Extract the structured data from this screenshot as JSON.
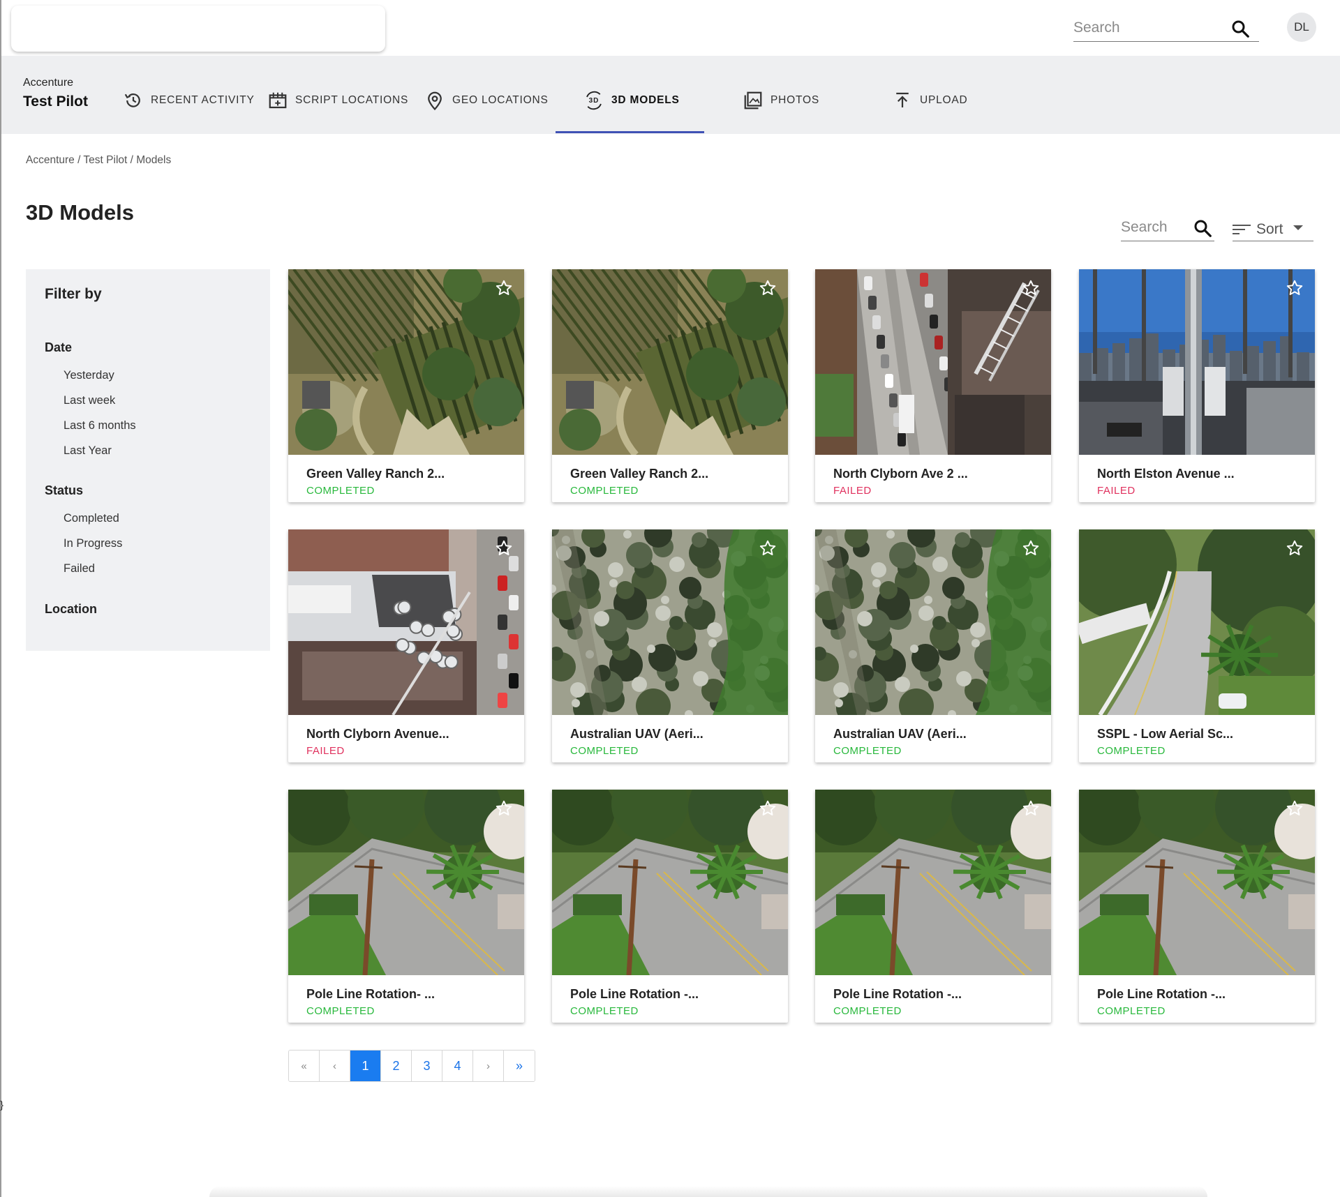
{
  "header": {
    "search_placeholder": "Search",
    "avatar_initials": "DL"
  },
  "project": {
    "org": "Accenture",
    "name": "Test Pilot"
  },
  "nav": {
    "items": [
      {
        "label": "RECENT ACTIVITY",
        "icon": "history-icon"
      },
      {
        "label": "SCRIPT LOCATIONS",
        "icon": "script-locations-icon"
      },
      {
        "label": "GEO LOCATIONS",
        "icon": "map-pin-icon"
      },
      {
        "label": "3D MODELS",
        "icon": "3d-rotation-icon"
      },
      {
        "label": "PHOTOS",
        "icon": "photo-library-icon"
      },
      {
        "label": "UPLOAD",
        "icon": "upload-icon"
      }
    ],
    "active": "3D MODELS"
  },
  "breadcrumb": "Accenture / Test Pilot / Models",
  "page_title": "3D Models",
  "toolbar": {
    "search_placeholder": "Search",
    "sort_label": "Sort"
  },
  "filter": {
    "title": "Filter by",
    "date_title": "Date",
    "date_options": [
      "Yesterday",
      "Last week",
      "Last 6 months",
      "Last Year"
    ],
    "status_title": "Status",
    "status_options": [
      "Completed",
      "In Progress",
      "Failed"
    ],
    "location_title": "Location"
  },
  "models": [
    {
      "name": "Green Valley Ranch 2...",
      "status": "COMPLETED",
      "thumb": "vineyard"
    },
    {
      "name": "Green Valley Ranch 2...",
      "status": "COMPLETED",
      "thumb": "vineyard"
    },
    {
      "name": "North Clyborn Ave 2 ...",
      "status": "FAILED",
      "thumb": "street-tower"
    },
    {
      "name": "North Elston Avenue ...",
      "status": "FAILED",
      "thumb": "tower-sky"
    },
    {
      "name": "North Clyborn Avenue...",
      "status": "FAILED",
      "thumb": "rooftop"
    },
    {
      "name": "Australian UAV (Aeri...",
      "status": "COMPLETED",
      "thumb": "scrubland"
    },
    {
      "name": "Australian UAV (Aeri...",
      "status": "COMPLETED",
      "thumb": "scrubland"
    },
    {
      "name": "SSPL - Low Aerial Sc...",
      "status": "COMPLETED",
      "thumb": "curved-road"
    },
    {
      "name": "Pole Line Rotation- ...",
      "status": "COMPLETED",
      "thumb": "pole-road"
    },
    {
      "name": "Pole Line Rotation -...",
      "status": "COMPLETED",
      "thumb": "pole-road"
    },
    {
      "name": "Pole Line Rotation -...",
      "status": "COMPLETED",
      "thumb": "pole-road"
    },
    {
      "name": "Pole Line Rotation -...",
      "status": "COMPLETED",
      "thumb": "pole-road"
    }
  ],
  "pagination": {
    "first": "«",
    "prev": "‹",
    "pages": [
      "1",
      "2",
      "3",
      "4"
    ],
    "current": "1",
    "next": "›",
    "last": "»"
  },
  "stray_char": "}",
  "colors": {
    "accent": "#3f51b5",
    "completed": "#28b83c",
    "failed": "#e0315e",
    "pager_active": "#1a7cf0"
  }
}
